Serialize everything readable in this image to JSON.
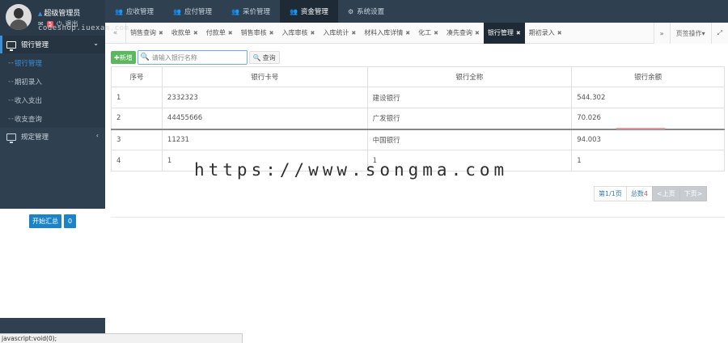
{
  "watermarks": {
    "top": "codeshop.iuexam.com",
    "center": "https://www.songma.com"
  },
  "user": {
    "name": "超级管理员",
    "badge_count": "5",
    "logout_label": "退出"
  },
  "sidebar": {
    "groups": [
      {
        "label": "银行管理",
        "items": [
          {
            "label": "银行管理"
          },
          {
            "label": "期初录入"
          },
          {
            "label": "收入支出"
          },
          {
            "label": "收支查询"
          }
        ]
      },
      {
        "label": "规定管理"
      }
    ],
    "summary_button": "开始汇总",
    "summary_count": "0"
  },
  "topnav": {
    "items": [
      {
        "label": "应收管理"
      },
      {
        "label": "应付管理"
      },
      {
        "label": "采价管理"
      },
      {
        "label": "资金管理"
      },
      {
        "label": "系统设置"
      }
    ]
  },
  "tabs": {
    "items": [
      {
        "label": "销售查询"
      },
      {
        "label": "收款单"
      },
      {
        "label": "付款单"
      },
      {
        "label": "销售审核"
      },
      {
        "label": "入库审核"
      },
      {
        "label": "入库统计"
      },
      {
        "label": "材料入库详情"
      },
      {
        "label": "化工"
      },
      {
        "label": "凑先查询"
      },
      {
        "label": "银行管理"
      },
      {
        "label": "期初录入"
      }
    ],
    "page_ops": "页签操作"
  },
  "toolbar": {
    "add_label": "新增",
    "search_placeholder": "请输入银行名称",
    "query_label": "查询"
  },
  "table": {
    "headers": [
      "序号",
      "银行卡号",
      "银行全称",
      "银行余额"
    ],
    "rows": [
      [
        "1",
        "2332323",
        "建设银行",
        "544.302"
      ],
      [
        "2",
        "44455666",
        "广发银行",
        "70.026"
      ],
      [
        "3",
        "11231",
        "中国银行",
        "94.003"
      ],
      [
        "4",
        "1",
        "1",
        "1"
      ]
    ]
  },
  "pager": {
    "page": "第1/1页",
    "total_prefix": "总数",
    "total": "4",
    "prev": "<上页",
    "next": "下页>"
  },
  "status_bar": "javascript:void(0);"
}
